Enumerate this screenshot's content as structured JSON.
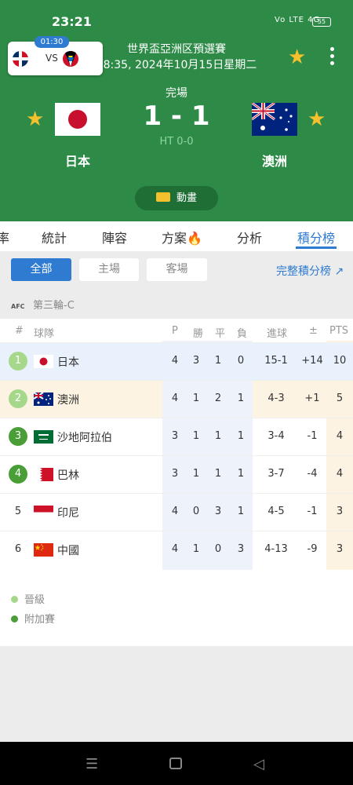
{
  "status_bar": {
    "time": "23:21",
    "signal": "Vo LTE 4G",
    "battery": "55"
  },
  "mini_match": {
    "time": "01:30",
    "vs": "VS"
  },
  "competition": {
    "name": "世界盃亞洲区預選賽",
    "datetime": "18:35, 2024年10月15日星期二"
  },
  "match": {
    "status": "完場",
    "score": "1 - 1",
    "halftime": "HT 0-0",
    "home": "日本",
    "away": "澳洲",
    "animation_label": "動畫"
  },
  "tabs": [
    "率",
    "統計",
    "陣容",
    "方案",
    "分析",
    "積分榜"
  ],
  "filters": {
    "all": "全部",
    "home": "主場",
    "away": "客場",
    "full_table": "完整積分榜"
  },
  "group": {
    "logo": "AFC",
    "name": "第三輪-C"
  },
  "table": {
    "headers": {
      "pos": "#",
      "team": "球隊",
      "p": "P",
      "w": "勝",
      "d": "平",
      "l": "負",
      "goals": "進球",
      "diff": "±",
      "pts": "PTS"
    },
    "rows": [
      {
        "rank": "1",
        "team": "日本",
        "p": "4",
        "w": "3",
        "d": "1",
        "l": "0",
        "goals": "15-1",
        "diff": "+14",
        "pts": "10"
      },
      {
        "rank": "2",
        "team": "澳洲",
        "p": "4",
        "w": "1",
        "d": "2",
        "l": "1",
        "goals": "4-3",
        "diff": "+1",
        "pts": "5"
      },
      {
        "rank": "3",
        "team": "沙地阿拉伯",
        "p": "3",
        "w": "1",
        "d": "1",
        "l": "1",
        "goals": "3-4",
        "diff": "-1",
        "pts": "4"
      },
      {
        "rank": "4",
        "team": "巴林",
        "p": "3",
        "w": "1",
        "d": "1",
        "l": "1",
        "goals": "3-7",
        "diff": "-4",
        "pts": "4"
      },
      {
        "rank": "5",
        "team": "印尼",
        "p": "4",
        "w": "0",
        "d": "3",
        "l": "1",
        "goals": "4-5",
        "diff": "-1",
        "pts": "3"
      },
      {
        "rank": "6",
        "team": "中國",
        "p": "4",
        "w": "1",
        "d": "0",
        "l": "3",
        "goals": "4-13",
        "diff": "-9",
        "pts": "3"
      }
    ]
  },
  "legend": {
    "qualify": "晉級",
    "playoff": "附加賽"
  },
  "colors": {
    "header_green": "#2e8b47",
    "accent_blue": "#2e7bd1",
    "qualify": "#a6d88b",
    "playoff": "#4a9e38",
    "star": "#f4c02e",
    "pts_bg": "#fdf3e3"
  },
  "icons": {
    "fav": "star-icon",
    "menu": "more-vert-icon",
    "fire": "fire-icon",
    "nav_recents": "menu-icon",
    "nav_home": "home-square-icon",
    "nav_back": "back-triangle-icon"
  }
}
